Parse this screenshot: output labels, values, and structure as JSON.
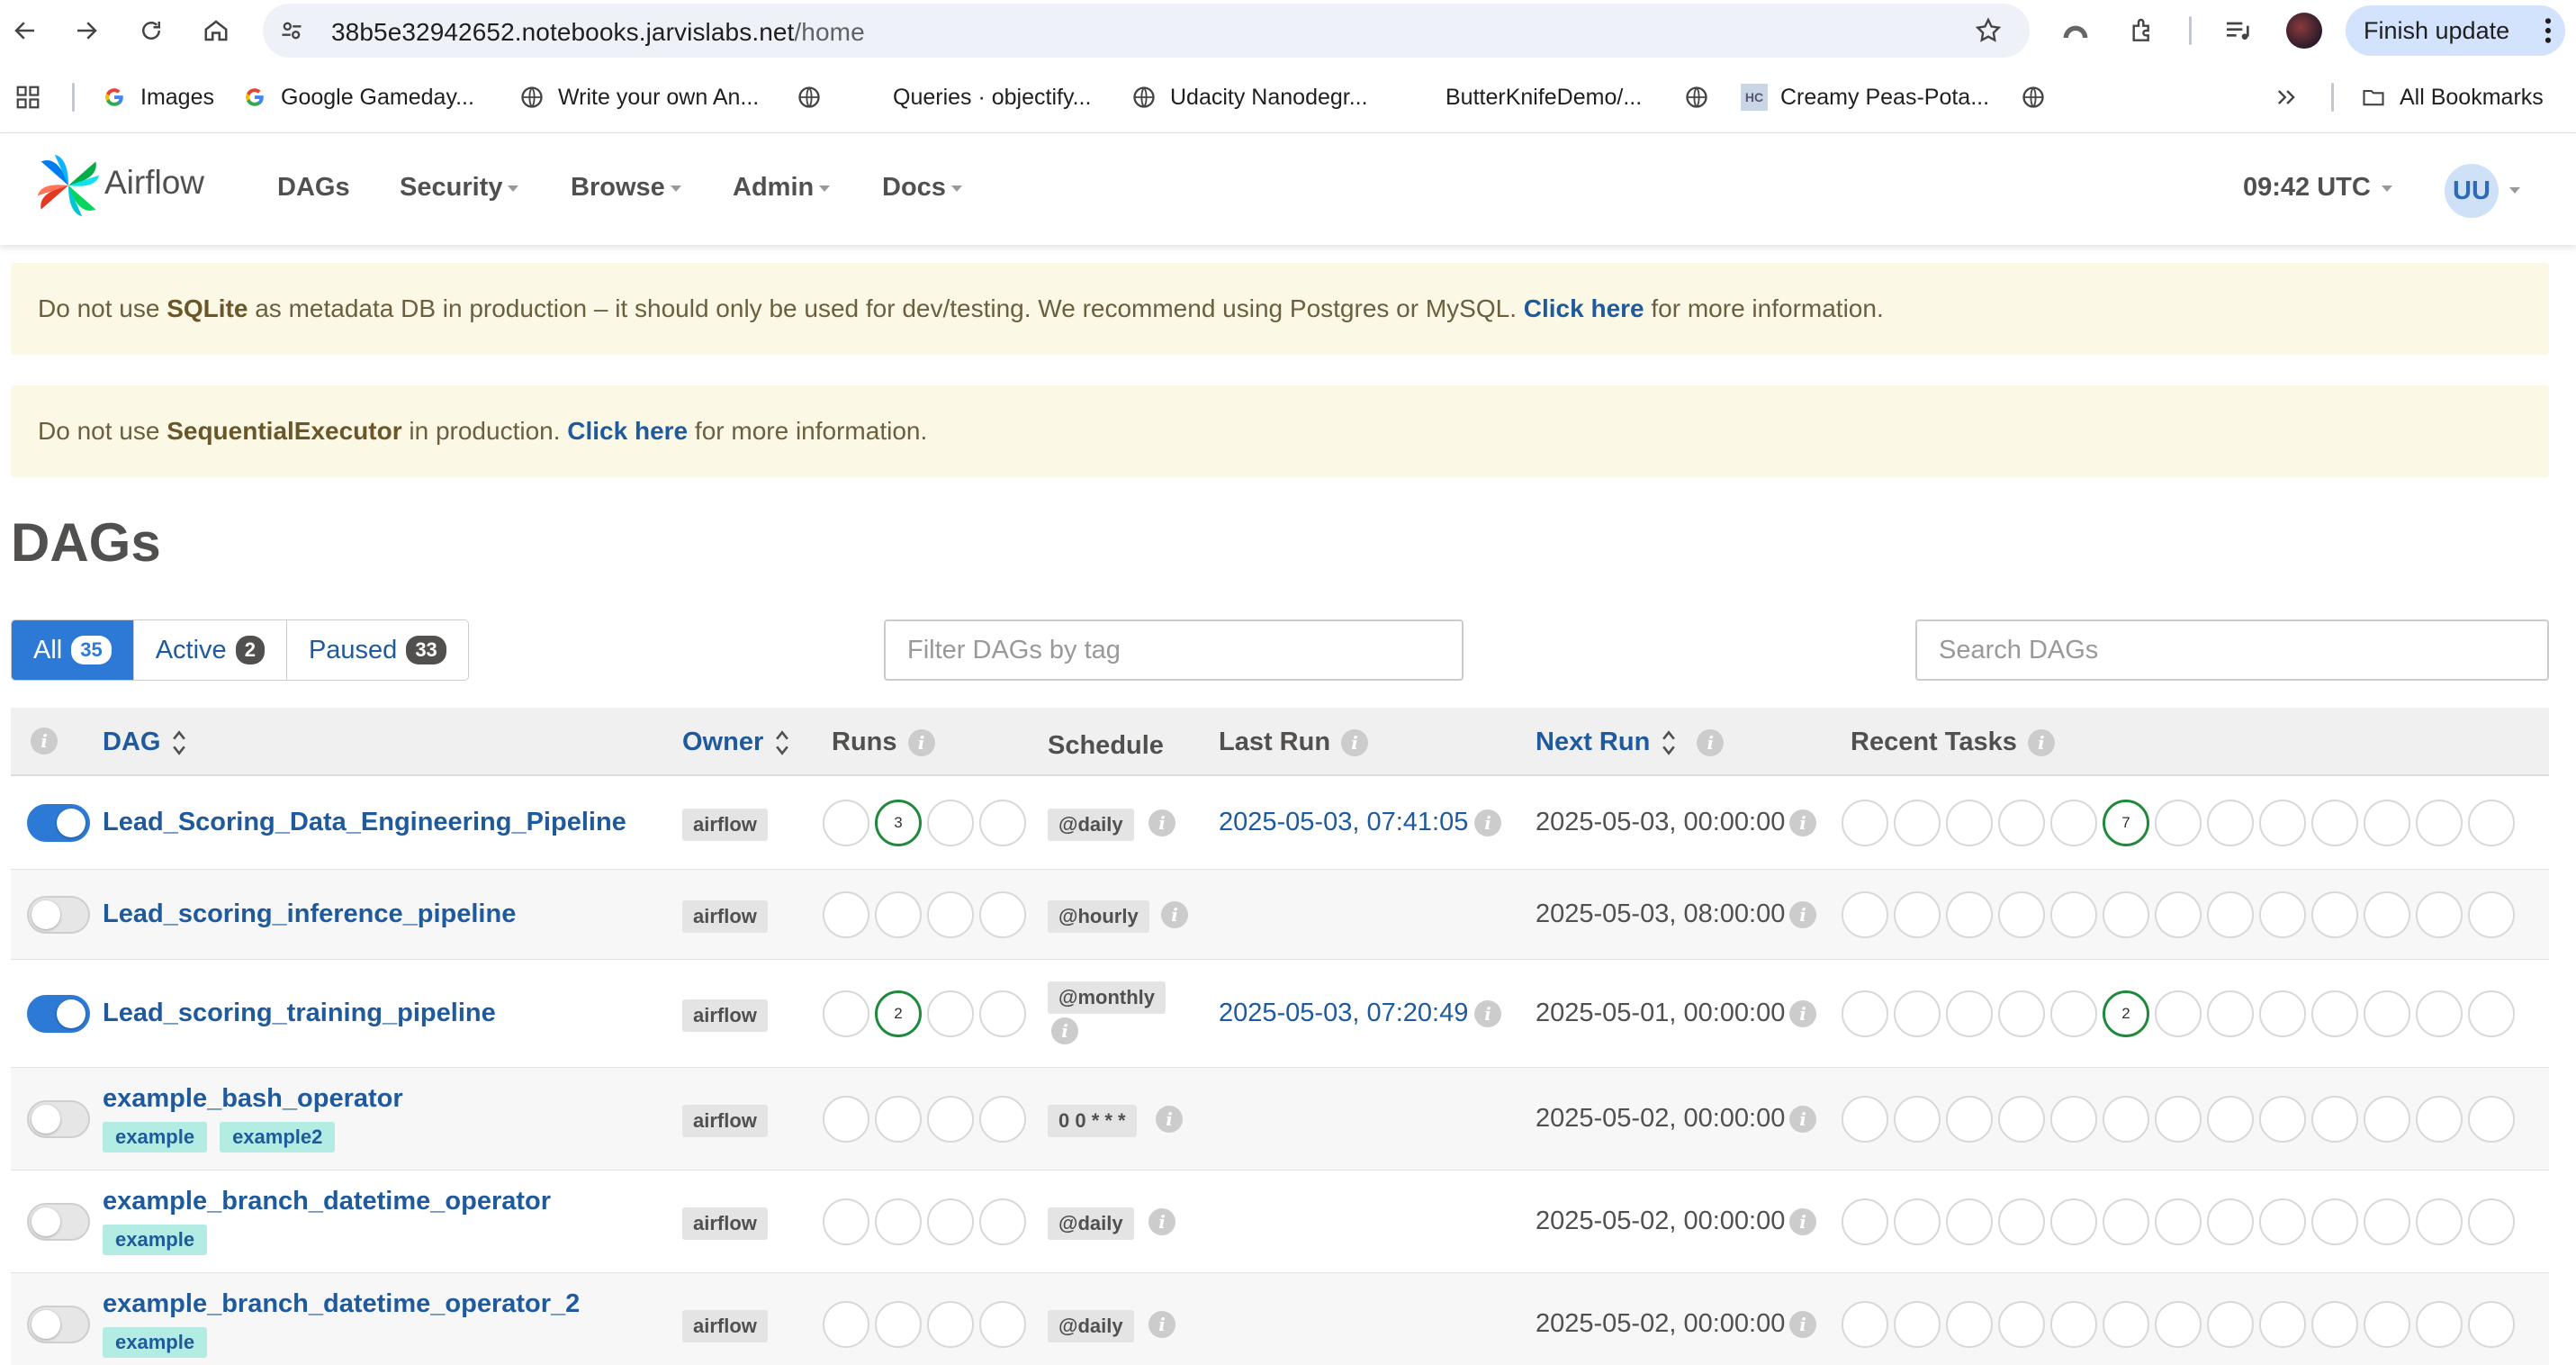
{
  "browser": {
    "url_host": "38b5e32942652.notebooks.jarvislabs.net",
    "url_path": "/home",
    "finish_update": "Finish update",
    "bookmarks": [
      {
        "label": "Images",
        "icon": "google-icon"
      },
      {
        "label": "Google Gameday...",
        "icon": "google-icon"
      },
      {
        "label": "Write your own An...",
        "icon": "globe-icon"
      },
      {
        "label": "",
        "icon": "globe-icon"
      },
      {
        "label": "Queries · objectify...",
        "icon": "none"
      },
      {
        "label": "Udacity Nanodegr...",
        "icon": "globe-icon"
      },
      {
        "label": "ButterKnifeDemo/...",
        "icon": "none"
      },
      {
        "label": "",
        "icon": "globe-icon"
      },
      {
        "label": "Creamy Peas-Pota...",
        "icon": "hc-icon"
      },
      {
        "label": "",
        "icon": "globe-icon"
      }
    ],
    "all_bookmarks": "All Bookmarks"
  },
  "airflow": {
    "brand": "Airflow",
    "menu": [
      "DAGs",
      "Security",
      "Browse",
      "Admin",
      "Docs"
    ],
    "time": "09:42 UTC",
    "user_initials": "UU"
  },
  "alerts": {
    "sqlite": {
      "pre": "Do not use ",
      "bold": "SQLite",
      "mid": " as metadata DB in production – it should only be used for dev/testing. We recommend using Postgres or MySQL. ",
      "link": "Click here",
      "post": " for more information."
    },
    "executor": {
      "pre": "Do not use ",
      "bold": "SequentialExecutor",
      "mid": " in production. ",
      "link": "Click here",
      "post": " for more information."
    }
  },
  "page_title": "DAGs",
  "filters": {
    "all": {
      "label": "All",
      "count": "35"
    },
    "active": {
      "label": "Active",
      "count": "2"
    },
    "paused": {
      "label": "Paused",
      "count": "33"
    },
    "tag_placeholder": "Filter DAGs by tag",
    "search_placeholder": "Search DAGs"
  },
  "columns": {
    "dag": "DAG",
    "owner": "Owner",
    "runs": "Runs",
    "schedule": "Schedule",
    "last_run": "Last Run",
    "next_run": "Next Run",
    "recent_tasks": "Recent Tasks"
  },
  "rows": [
    {
      "name": "Lead_Scoring_Data_Engineering_Pipeline",
      "active": true,
      "tags": [],
      "owner": "airflow",
      "runs": [
        "",
        "3",
        "",
        ""
      ],
      "schedule": "@daily",
      "last_run": "2025-05-03, 07:41:05",
      "next_run": "2025-05-03, 00:00:00",
      "recent_task_count": "7"
    },
    {
      "name": "Lead_scoring_inference_pipeline",
      "active": false,
      "tags": [],
      "owner": "airflow",
      "runs": [
        "",
        "",
        "",
        ""
      ],
      "schedule": "@hourly",
      "last_run": "",
      "next_run": "2025-05-03, 08:00:00",
      "recent_task_count": ""
    },
    {
      "name": "Lead_scoring_training_pipeline",
      "active": true,
      "tags": [],
      "owner": "airflow",
      "runs": [
        "",
        "2",
        "",
        ""
      ],
      "schedule": "@monthly",
      "last_run": "2025-05-03, 07:20:49",
      "next_run": "2025-05-01, 00:00:00",
      "recent_task_count": "2"
    },
    {
      "name": "example_bash_operator",
      "active": false,
      "tags": [
        "example",
        "example2"
      ],
      "owner": "airflow",
      "runs": [
        "",
        "",
        "",
        ""
      ],
      "schedule": "0 0 * * *",
      "last_run": "",
      "next_run": "2025-05-02, 00:00:00",
      "recent_task_count": ""
    },
    {
      "name": "example_branch_datetime_operator",
      "active": false,
      "tags": [
        "example"
      ],
      "owner": "airflow",
      "runs": [
        "",
        "",
        "",
        ""
      ],
      "schedule": "@daily",
      "last_run": "",
      "next_run": "2025-05-02, 00:00:00",
      "recent_task_count": ""
    },
    {
      "name": "example_branch_datetime_operator_2",
      "active": false,
      "tags": [
        "example"
      ],
      "owner": "airflow",
      "runs": [
        "",
        "",
        "",
        ""
      ],
      "schedule": "@daily",
      "last_run": "",
      "next_run": "2025-05-02, 00:00:00",
      "recent_task_count": ""
    }
  ],
  "colors": {
    "link": "#1e5a9c",
    "active": "#2d7ad6",
    "success": "#1f8a3c",
    "alert_bg": "#fbf8e5",
    "tag_bg": "#b2ece3"
  }
}
